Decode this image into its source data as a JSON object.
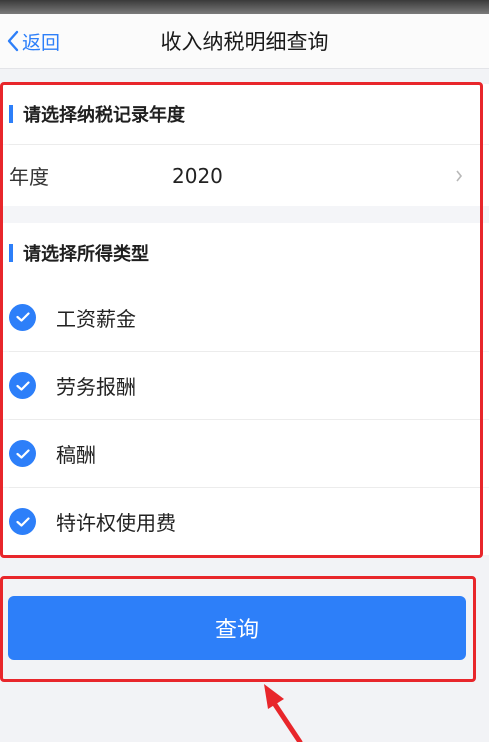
{
  "nav": {
    "back_label": "返回",
    "title": "收入纳税明细查询"
  },
  "year_section": {
    "heading": "请选择纳税记录年度",
    "year_label": "年度",
    "year_value": "2020"
  },
  "income_section": {
    "heading": "请选择所得类型",
    "options": [
      {
        "label": "工资薪金",
        "checked": true
      },
      {
        "label": "劳务报酬",
        "checked": true
      },
      {
        "label": "稿酬",
        "checked": true
      },
      {
        "label": "特许权使用费",
        "checked": true
      }
    ]
  },
  "query_button": "查询",
  "colors": {
    "accent": "#2d7ff9",
    "highlight": "#e8262b"
  }
}
